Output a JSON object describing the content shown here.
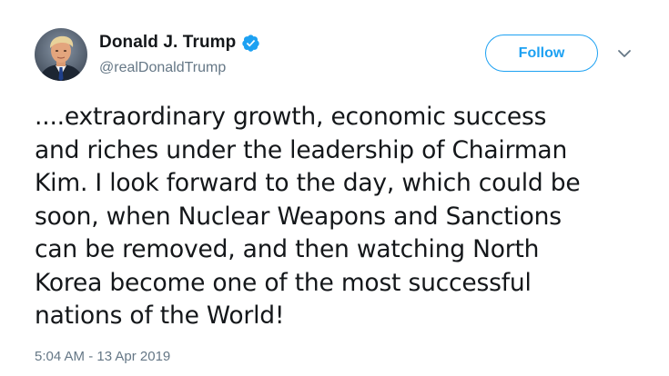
{
  "author": {
    "display_name": "Donald J. Trump",
    "handle": "@realDonaldTrump",
    "verified": true
  },
  "header": {
    "follow_label": "Follow"
  },
  "tweet": {
    "text": "....extraordinary growth, economic success\nand riches under the leadership of Chairman\nKim. I look forward to the day, which could be\nsoon, when Nuclear Weapons and Sanctions\ncan be removed, and then watching North\nKorea become one of the most successful\nnations of the World!",
    "timestamp": "5:04 AM - 13 Apr 2019"
  },
  "icons": {
    "verified": "verified-badge-icon",
    "caret": "chevron-down-icon"
  },
  "colors": {
    "accent": "#1da1f2",
    "text": "#14171a",
    "secondary_text": "#657786"
  }
}
